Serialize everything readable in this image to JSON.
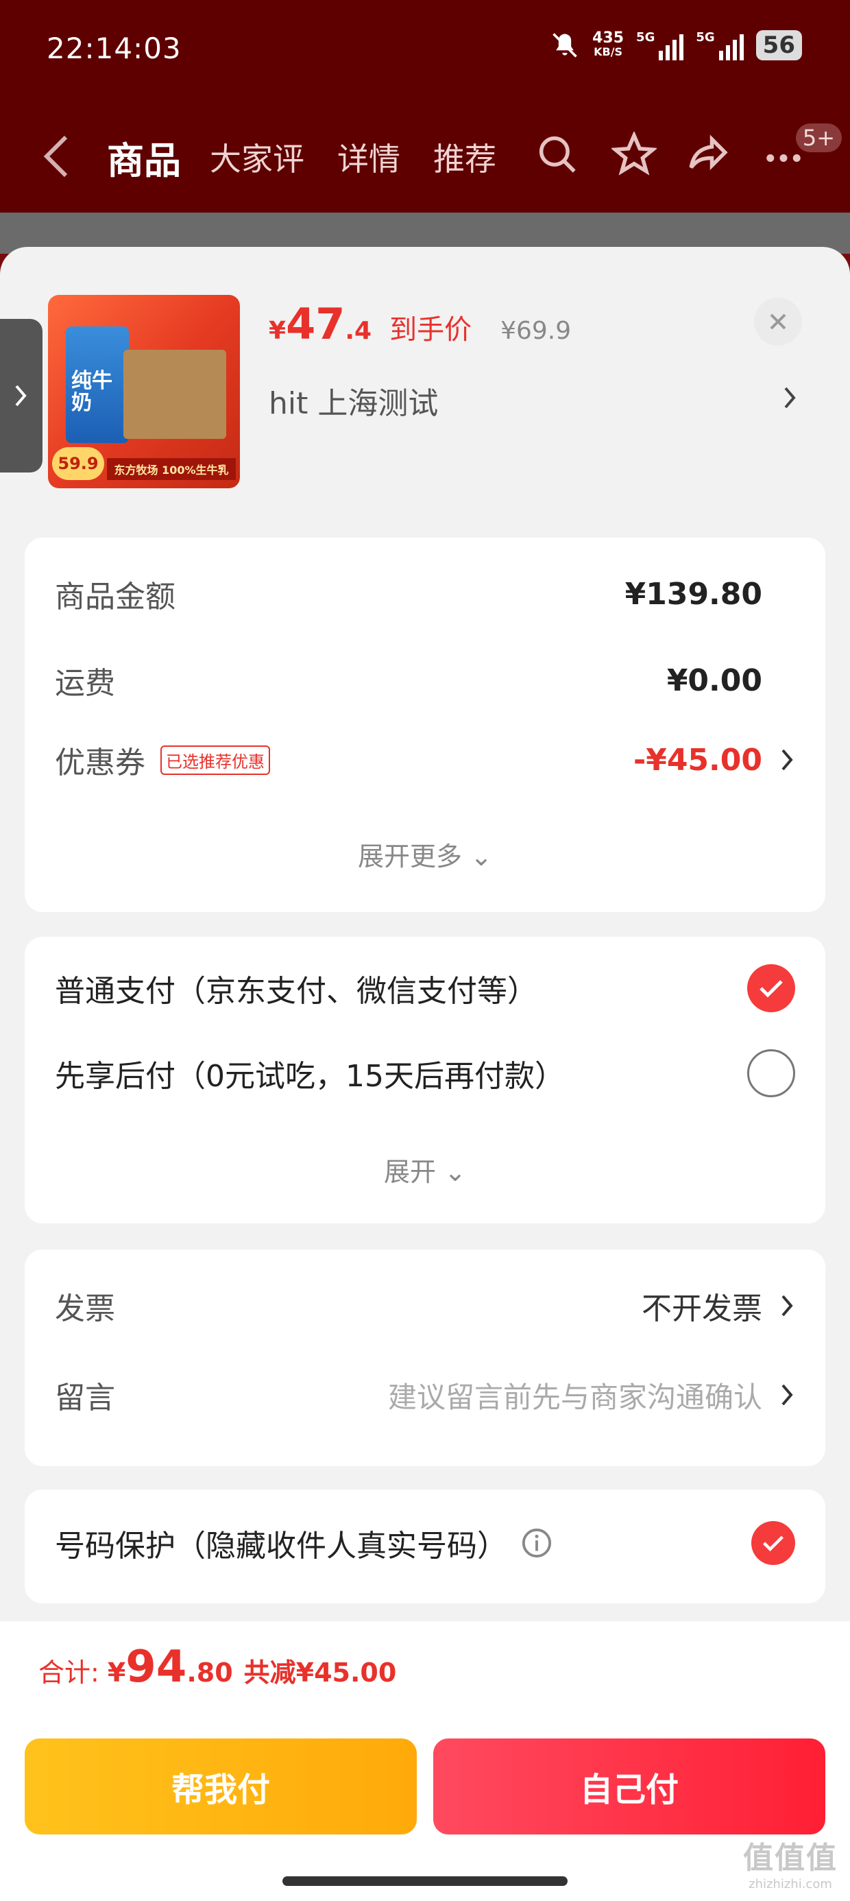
{
  "status_bar": {
    "time": "22:14:03",
    "net_speed_value": "435",
    "net_speed_unit": "KB/S",
    "signal1_label": "5G",
    "signal2_label": "5G",
    "battery": "56"
  },
  "nav": {
    "tabs": [
      "商品",
      "大家评",
      "详情",
      "推荐"
    ],
    "active_tab": 0,
    "more_badge": "5+"
  },
  "product": {
    "image_price": "59.9",
    "image_strip": "东方牧场 100%生牛乳",
    "image_box_text": "纯牛奶",
    "price_symbol": "¥",
    "price_int": "47",
    "price_dec": ".4",
    "price_label": "到手价",
    "original_price": "¥69.9",
    "name": "hit  上海测试"
  },
  "summary": {
    "goods_amount_label": "商品金额",
    "goods_amount": "¥139.80",
    "shipping_label": "运费",
    "shipping": "¥0.00",
    "coupon_label": "优惠券",
    "coupon_tag": "已选推荐优惠",
    "coupon_value": "-¥45.00",
    "expand_more": "展开更多 ⌄"
  },
  "payment": {
    "options": [
      {
        "label": "普通支付（京东支付、微信支付等）",
        "selected": true
      },
      {
        "label": "先享后付（0元试吃，15天后再付款）",
        "selected": false
      }
    ],
    "expand": "展开 ⌄"
  },
  "extras": {
    "invoice_label": "发票",
    "invoice_value": "不开发票",
    "message_label": "留言",
    "message_placeholder": "建议留言前先与商家沟通确认"
  },
  "privacy": {
    "label": "号码保护（隐藏收件人真实号码）",
    "checked": true
  },
  "footer": {
    "total_label": "合计:",
    "total_symbol": "¥",
    "total_int": "94",
    "total_dec": ".80",
    "total_saved": "共减¥45.00",
    "help_pay": "帮我付",
    "self_pay": "自己付"
  },
  "watermark": {
    "line1": "值值值",
    "line2": "zhizhizhi.com"
  },
  "colors": {
    "accent_red": "#e8312b",
    "header_bg": "#5e0000",
    "help_btn": "#ffb412",
    "self_btn": "#ff2d44"
  }
}
